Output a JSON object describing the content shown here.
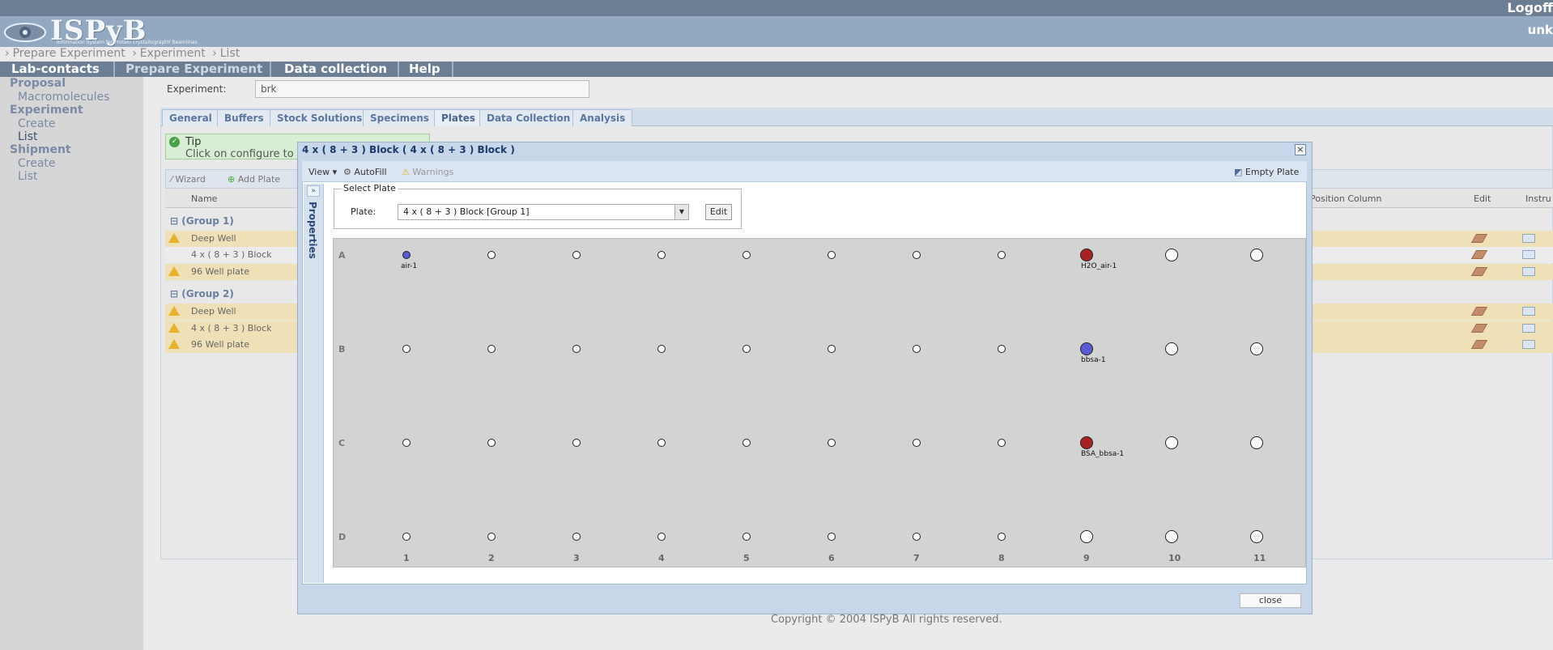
{
  "app": {
    "logo_text": "ISPyB",
    "logo_subtitle": "Information System for Protein crystallographY Beamlines",
    "logoff": "Logoff",
    "user": "unk"
  },
  "breadcrumb": [
    "Prepare Experiment",
    "Experiment",
    "List"
  ],
  "nav": [
    "Lab-contacts",
    "Prepare Experiment",
    "Data collection",
    "Help"
  ],
  "sidebar": {
    "proposal": "Proposal",
    "macromolecules": "Macromolecules",
    "experiment": "Experiment",
    "exp_create": "Create",
    "exp_list": "List",
    "shipment": "Shipment",
    "ship_create": "Create",
    "ship_list": "List"
  },
  "experiment": {
    "label": "Experiment:",
    "value": "brk"
  },
  "tabs": [
    "General",
    "Buffers",
    "Stock Solutions",
    "Specimens",
    "Plates",
    "Data Collection",
    "Analysis"
  ],
  "tip": {
    "title": "Tip",
    "text": "Click on configure to ac"
  },
  "toolbar": {
    "wizard": "Wizard",
    "add_plate": "Add Plate"
  },
  "grid": {
    "col_name": "Name",
    "col_position": "Position Column",
    "col_edit": "Edit",
    "col_instr": "Instru",
    "group1": "(Group 1)",
    "group2": "(Group 2)",
    "rows": [
      {
        "name": "Deep Well"
      },
      {
        "name": "4 x ( 8 + 3 ) Block"
      },
      {
        "name": "96 Well plate"
      },
      {
        "name": "Deep Well"
      },
      {
        "name": "4 x ( 8 + 3 ) Block"
      },
      {
        "name": "96 Well plate"
      }
    ]
  },
  "dialog": {
    "title": "4 x ( 8 + 3 ) Block ( 4 x ( 8 + 3 ) Block )",
    "close_x": "×",
    "view": "View",
    "autofill": "AutoFill",
    "warnings": "Warnings",
    "empty_plate": "Empty Plate",
    "properties": "Properties",
    "properties_arrow": "»",
    "select_plate_legend": "Select Plate",
    "plate_label": "Plate:",
    "plate_value": "4 x ( 8 + 3 ) Block [Group 1]",
    "edit": "Edit",
    "close_button": "close"
  },
  "plate": {
    "rows": [
      "A",
      "B",
      "C",
      "D"
    ],
    "columns": [
      "1",
      "2",
      "3",
      "4",
      "5",
      "6",
      "7",
      "8",
      "9",
      "10",
      "11"
    ],
    "filled": [
      {
        "row": "A",
        "col": "1",
        "label": "air-1",
        "color": "#5b5bd6"
      },
      {
        "row": "A",
        "col": "9",
        "label": "H2O_air-1",
        "color": "#a82222"
      },
      {
        "row": "B",
        "col": "9",
        "label": "bbsa-1",
        "color": "#5b5bd6"
      },
      {
        "row": "C",
        "col": "9",
        "label": "BSA_bbsa-1",
        "color": "#a82222"
      }
    ]
  },
  "footer": {
    "copyright": "Copyright © 2004 ISPyB All rights reserved."
  }
}
